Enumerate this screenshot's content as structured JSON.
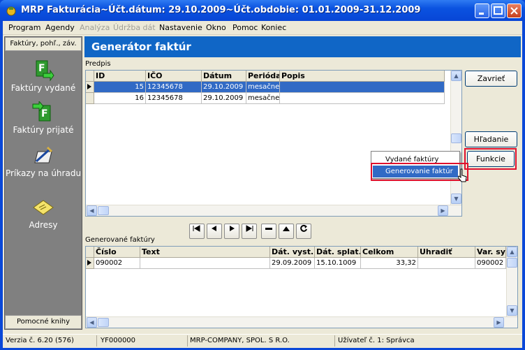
{
  "window": {
    "title": "MRP Fakturácia~Účt.dátum: 29.10.2009~Účt.obdobie: 01.01.2009-31.12.2009"
  },
  "menu": [
    "Program",
    "Agendy",
    "Analýza",
    "Údržba dát",
    "Nastavenie",
    "Okno",
    "Pomoc",
    "Koniec"
  ],
  "menu_disabled": [
    "Analýza",
    "Údržba dát"
  ],
  "sidebar": {
    "header": "Faktúry, pohľ., záv.",
    "footer": "Pomocné knihy",
    "items": [
      {
        "label": "Faktúry vydané",
        "icon": "invoice-out-icon"
      },
      {
        "label": "Faktúry prijaté",
        "icon": "invoice-in-icon"
      },
      {
        "label": "Príkazy na úhradu",
        "icon": "payment-order-icon"
      },
      {
        "label": "Adresy",
        "icon": "address-book-icon"
      }
    ]
  },
  "main": {
    "title": "Generátor faktúr",
    "predpis_label": "Predpis",
    "predpis_columns": [
      "ID",
      "IČO",
      "Dátum",
      "Perióda",
      "Popis"
    ],
    "predpis_rows": [
      {
        "id": "15",
        "ico": "12345678",
        "datum": "29.10.2009",
        "perioda": "mesačne",
        "popis": "",
        "selected": true
      },
      {
        "id": "16",
        "ico": "12345678",
        "datum": "29.10.2009",
        "perioda": "mesačne",
        "popis": "",
        "selected": false
      }
    ],
    "buttons": {
      "close": "Zavrieť",
      "search": "Hľadanie",
      "functions": "Funkcie"
    },
    "popup_menu": [
      "Vydané faktúry",
      "Generovanie faktúr"
    ],
    "generated_label": "Generované faktúry",
    "generated_columns": [
      "Číslo",
      "Text",
      "Dát. vyst.",
      "Dát. splat.",
      "Celkom",
      "Uhradiť",
      "Var. sy"
    ],
    "generated_rows": [
      {
        "cislo": "090002",
        "text": "",
        "vyst": "29.09.2009",
        "splat": "15.10.1009",
        "celkom": "33,32",
        "uhradit": "",
        "varsy": "090002"
      }
    ]
  },
  "statusbar": {
    "version": "Verzia č. 6.20 (576)",
    "code": "YF000000",
    "company": "MRP-COMPANY, SPOL. S R.O.",
    "user": "Užívateľ č. 1: Správca"
  },
  "colors": {
    "title_blue": "#0a52e0",
    "header_blue": "#1066c6",
    "selection": "#316ac5",
    "highlight_red": "#e0102c"
  }
}
